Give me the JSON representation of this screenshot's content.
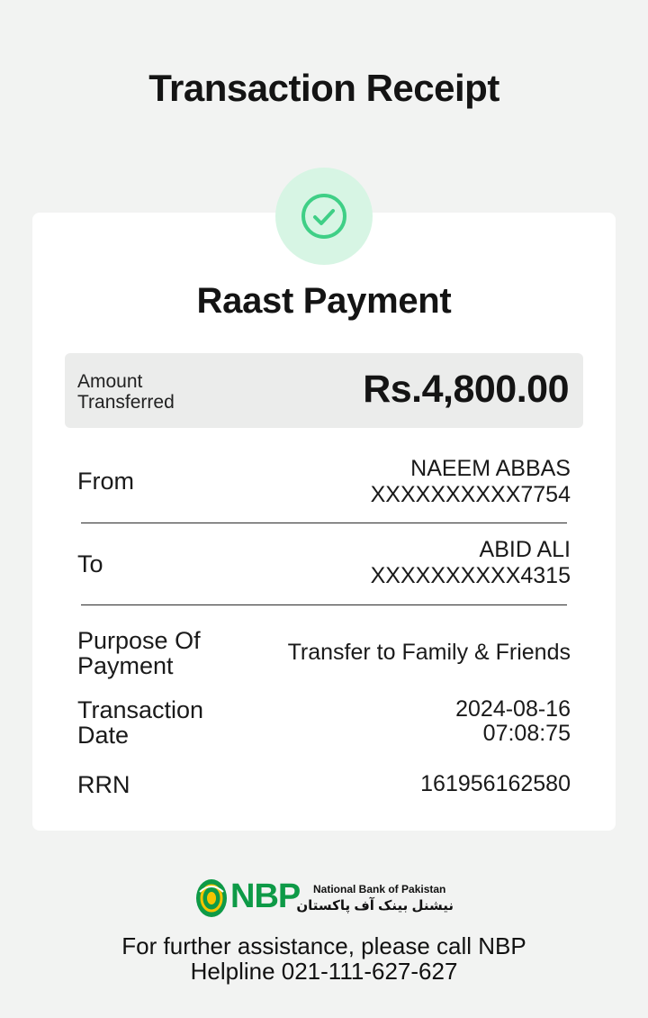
{
  "header": {
    "title": "Transaction Receipt"
  },
  "receipt": {
    "payment_type": "Raast Payment",
    "amount_label": "Amount Transferred",
    "amount": "Rs.4,800.00",
    "from_label": "From",
    "from_name": "NAEEM ABBAS",
    "from_account": "XXXXXXXXXX7754",
    "to_label": "To",
    "to_name": "ABID ALI",
    "to_account": "XXXXXXXXXX4315",
    "purpose_label": "Purpose Of Payment",
    "purpose": "Transfer to Family & Friends",
    "date_label": "Transaction Date",
    "date": "2024-08-16",
    "time": "07:08:75",
    "rrn_label": "RRN",
    "rrn": "161956162580"
  },
  "footer": {
    "logo_text": "NBP",
    "bank_name_en": "National Bank of Pakistan",
    "bank_name_ur": "نیشنل بینک آف پاکستان",
    "help_text": "For further assistance, please call NBP Helpline 021-111-627-627"
  },
  "colors": {
    "success_bg": "#d7f5e4",
    "success_icon": "#3fcf86",
    "brand_green": "#0e9a47"
  }
}
